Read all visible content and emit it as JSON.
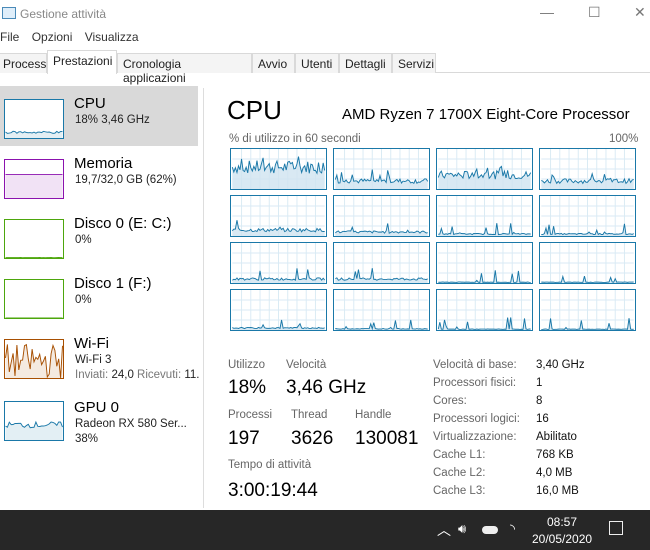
{
  "window": {
    "title": "Gestione attività",
    "minimize": "—",
    "maximize": "☐",
    "close": "✕"
  },
  "menu": [
    "File",
    "Opzioni",
    "Visualizza"
  ],
  "tabs": [
    "Processi",
    "Prestazioni",
    "Cronologia applicazioni",
    "Avvio",
    "Utenti",
    "Dettagli",
    "Servizi"
  ],
  "active_tab": "Prestazioni",
  "sidebar": [
    {
      "title": "CPU",
      "sub1": "18% 3,46 GHz",
      "color": "#1a78a8"
    },
    {
      "title": "Memoria",
      "sub1": "19,7/32,0 GB (62%)",
      "color": "#8b12ae"
    },
    {
      "title": "Disco 0 (E: C:)",
      "sub1": "0%",
      "color": "#4da60c"
    },
    {
      "title": "Disco 1 (F:)",
      "sub1": "0%",
      "color": "#4da60c"
    },
    {
      "title": "Wi-Fi",
      "sub1": "Wi-Fi 3",
      "sub2_label1": "Inviati:",
      "sub2_val1": "24,0",
      "sub2_label2": "Ricevuti:",
      "sub2_val2": "11.",
      "color": "#a74f01"
    },
    {
      "title": "GPU 0",
      "sub1": "Radeon RX 580 Ser...",
      "sub2": "38%",
      "color": "#1a78a8"
    }
  ],
  "main": {
    "title": "CPU",
    "model": "AMD Ryzen 7 1700X Eight-Core Processor",
    "graph_label": "% di utilizzo in 60 secondi",
    "graph_max": "100%",
    "stats": {
      "utilizzo_label": "Utilizzo",
      "utilizzo": "18%",
      "velocita_label": "Velocità",
      "velocita": "3,46 GHz",
      "processi_label": "Processi",
      "processi": "197",
      "thread_label": "Thread",
      "thread": "3626",
      "handle_label": "Handle",
      "handle": "130081",
      "uptime_label": "Tempo di attività",
      "uptime": "3:00:19:44"
    },
    "details": [
      [
        "Velocità di base:",
        "3,40 GHz"
      ],
      [
        "Processori fisici:",
        "1"
      ],
      [
        "Cores:",
        "8"
      ],
      [
        "Processori logici:",
        "16"
      ],
      [
        "Virtualizzazione:",
        "Abilitato"
      ],
      [
        "Cache L1:",
        "768 KB"
      ],
      [
        "Cache L2:",
        "4,0 MB"
      ],
      [
        "Cache L3:",
        "16,0 MB"
      ]
    ]
  },
  "taskbar": {
    "time": "08:57",
    "date": "20/05/2020"
  }
}
